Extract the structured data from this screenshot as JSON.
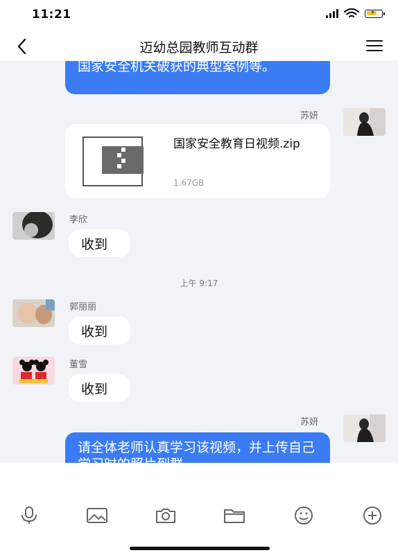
{
  "status_bar": {
    "time": "11:21"
  },
  "header": {
    "title": "迈幼总园教师互动群"
  },
  "messages": {
    "m1_text": "国家安全机关破获的典型案例等。",
    "m2_sender": "苏妍",
    "m2_file_name": "国家安全教育日视频.zip",
    "m2_file_size": "1.67GB",
    "m3_sender": "李欣",
    "m3_text": "收到",
    "time_divider": "上午 9:17",
    "m4_sender": "郭丽丽",
    "m4_text": "收到",
    "m5_sender": "董雪",
    "m5_text": "收到",
    "m6_sender": "苏妍",
    "m6_text": "请全体老师认真学习该视频，并上传自己学习时的照片到群"
  },
  "input_bar": {
    "icons": [
      "voice-icon",
      "image-icon",
      "camera-icon",
      "folder-icon",
      "emoji-icon",
      "plus-icon"
    ]
  },
  "colors": {
    "accent": "#3b7cf4",
    "background": "#f2f3f7"
  }
}
